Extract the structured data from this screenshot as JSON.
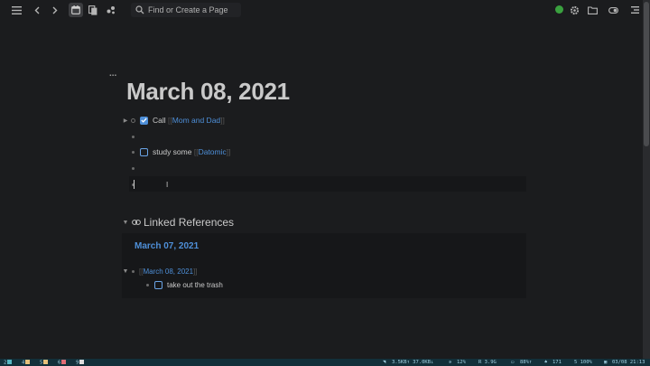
{
  "toolbar": {
    "search_placeholder": "Find or Create a Page",
    "icons": [
      "menu-icon",
      "back-icon",
      "forward-icon",
      "daily-notes-icon",
      "all-pages-icon",
      "graph-icon",
      "search-icon",
      "settings-icon",
      "folder-icon",
      "toggle-icon",
      "right-sidebar-icon"
    ],
    "sync_color": "#3aa13f"
  },
  "page": {
    "title": "March 08, 2021",
    "title_menu": "...",
    "blocks": [
      {
        "type": "todo",
        "checked": true,
        "prefix": "Call",
        "ref": "Mom and Dad"
      },
      {
        "type": "empty"
      },
      {
        "type": "todo",
        "checked": false,
        "prefix": "study some",
        "ref": "Datomic"
      },
      {
        "type": "empty"
      },
      {
        "type": "editing"
      }
    ]
  },
  "linked_references": {
    "title": "Linked References",
    "groups": [
      {
        "date": "March 07, 2021",
        "parent_ref": "March 08, 2021",
        "child_text": "take out the trash",
        "child_checked": false
      }
    ]
  },
  "status_bar": {
    "workspaces": [
      {
        "num": "2",
        "color": "#56b6c2"
      },
      {
        "num": "4",
        "color": "#e5c07b"
      },
      {
        "num": "5",
        "color": "#e5c07b"
      },
      {
        "num": "6",
        "color": "#e06c75"
      },
      {
        "num": "9",
        "color": "#dcdcdc"
      }
    ],
    "network": "3.5KB↑ 37.0KB↓",
    "cpu": "12%",
    "ram": "R 3.9G",
    "battery": "88%↑",
    "notifications": "171",
    "volume": "5 100%",
    "datetime": "03/08 21:13"
  },
  "colors": {
    "accent": "#4e8fd8",
    "background": "#1b1c1e",
    "block_bg": "#161719",
    "status_bg": "#12303a"
  }
}
